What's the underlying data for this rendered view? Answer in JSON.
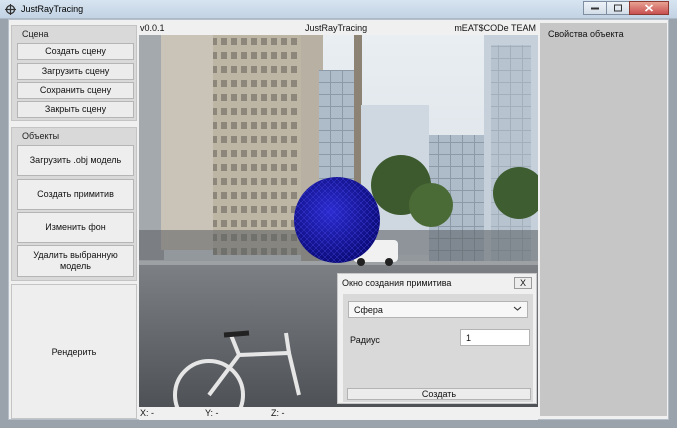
{
  "window": {
    "title": "JustRayTracing"
  },
  "scene_group": {
    "title": "Сцена",
    "create_label": "Создать сцену",
    "load_label": "Загрузить сцену",
    "save_label": "Сохранить сцену",
    "close_label": "Закрыть сцену"
  },
  "objects_group": {
    "title": "Объекты",
    "load_obj_label": "Загрузить .obj модель",
    "create_primitive_label": "Создать примитив",
    "change_bg_label": "Изменить фон",
    "delete_label": "Удалить выбранную модель"
  },
  "render": {
    "label": "Рендерить"
  },
  "viewport": {
    "version": "v0.0.1",
    "title": "JustRayTracing",
    "team": "mEAT$CODe TEAM",
    "x_label": "X: -",
    "y_label": "Y: -",
    "z_label": "Z: -",
    "sphere_color": "#1a1aa8"
  },
  "primitive_dialog": {
    "title": "Окно создания примитива",
    "close_label": "X",
    "selected_primitive": "Сфера",
    "radius_label": "Радиус",
    "radius_value": "1",
    "create_label": "Создать"
  },
  "properties": {
    "title": "Свойства объекта"
  }
}
